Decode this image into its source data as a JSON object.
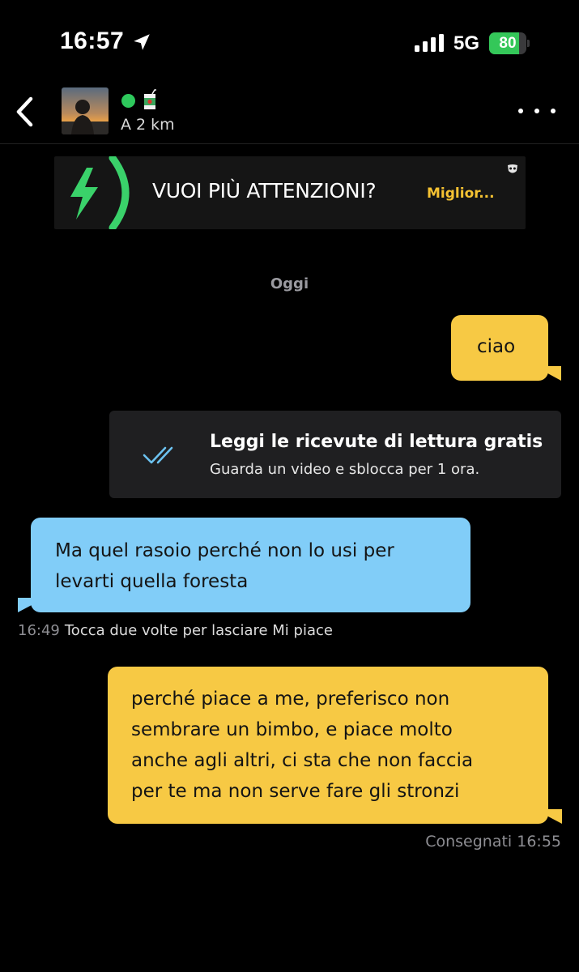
{
  "status_bar": {
    "time": "16:57",
    "network": "5G",
    "battery_label": "80",
    "battery_level": 0.8,
    "icons": [
      "location-arrow-icon",
      "cellular-signal-icon",
      "battery-icon"
    ]
  },
  "header": {
    "distance": "A 2 km",
    "online_color": "#2ec95c",
    "icons": [
      "chevron-left-icon",
      "juice-box-icon",
      "more-options-icon"
    ]
  },
  "promo": {
    "text": "VUOI PIÙ ATTENZIONI?",
    "link": "Miglior...",
    "accent_color": "#f5c232",
    "icons": [
      "lightning-icon",
      "grindr-mask-icon"
    ]
  },
  "chat": {
    "date_separator": "Oggi",
    "messages": [
      {
        "sender": "me",
        "text": "ciao"
      },
      {
        "sender": "them",
        "lines": [
          "Ma quel rasoio perché non lo usi per",
          "levarti quella foresta"
        ],
        "time": "16:49",
        "hint": "Tocca due volte per lasciare Mi piace"
      },
      {
        "sender": "me",
        "lines": [
          "perché piace a me, preferisco non",
          "sembrare un bimbo, e piace molto",
          "anche agli altri, ci sta che non faccia",
          "per te ma non serve fare gli stronzi"
        ],
        "status": "Consegnati 16:55"
      }
    ],
    "receipts_card": {
      "title": "Leggi le ricevute di lettura gratis",
      "subtitle": "Guarda un video e sblocca per 1 ora.",
      "icon": "double-check-icon"
    },
    "colors": {
      "my_bubble": "#f7c944",
      "their_bubble": "#81cdf8"
    }
  }
}
